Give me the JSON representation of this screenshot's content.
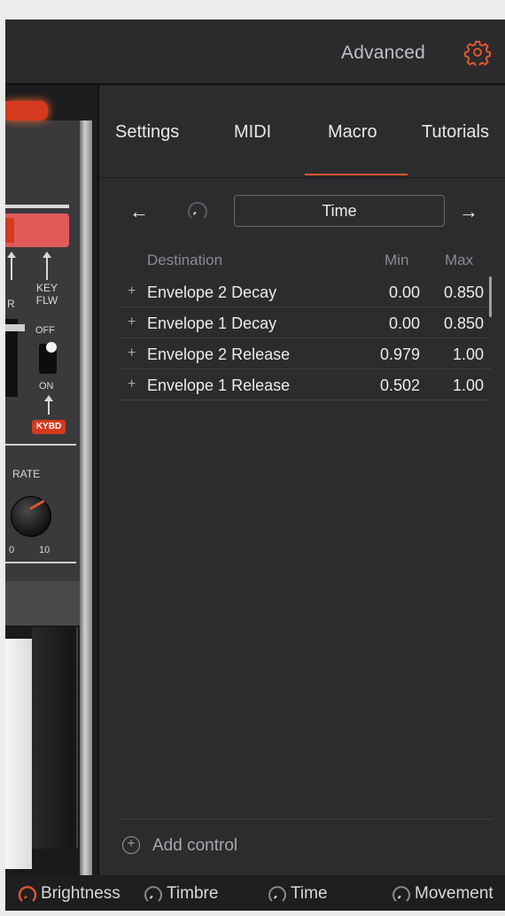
{
  "header": {
    "title": "Advanced",
    "settings_icon": "gear-icon",
    "accent_color": "#e0572d"
  },
  "synth": {
    "labels": {
      "r": "R",
      "key_flw": "KEY\nFLW",
      "off": "OFF",
      "on": "ON",
      "kybd": "KYBD",
      "rate": "RATE",
      "rate_min": "0",
      "rate_max": "10"
    }
  },
  "tabs": [
    {
      "label": "Settings",
      "active": false
    },
    {
      "label": "MIDI",
      "active": false
    },
    {
      "label": "Macro",
      "active": true
    },
    {
      "label": "Tutorials",
      "active": false
    }
  ],
  "macro_nav": {
    "prev_icon": "arrow-left-icon",
    "next_icon": "arrow-right-icon",
    "selected_macro": "Time"
  },
  "table": {
    "headers": {
      "destination": "Destination",
      "min": "Min",
      "max": "Max"
    },
    "rows": [
      {
        "destination": "Envelope 2 Decay",
        "min": "0.00",
        "max": "0.850"
      },
      {
        "destination": "Envelope 1 Decay",
        "min": "0.00",
        "max": "0.850"
      },
      {
        "destination": "Envelope 2 Release",
        "min": "0.979",
        "max": "1.00"
      },
      {
        "destination": "Envelope 1 Release",
        "min": "0.502",
        "max": "1.00"
      }
    ]
  },
  "add_control": {
    "label": "Add control"
  },
  "bottom_macros": [
    {
      "label": "Brightness",
      "active": true
    },
    {
      "label": "Timbre",
      "active": false
    },
    {
      "label": "Time",
      "active": false
    },
    {
      "label": "Movement",
      "active": false
    }
  ]
}
